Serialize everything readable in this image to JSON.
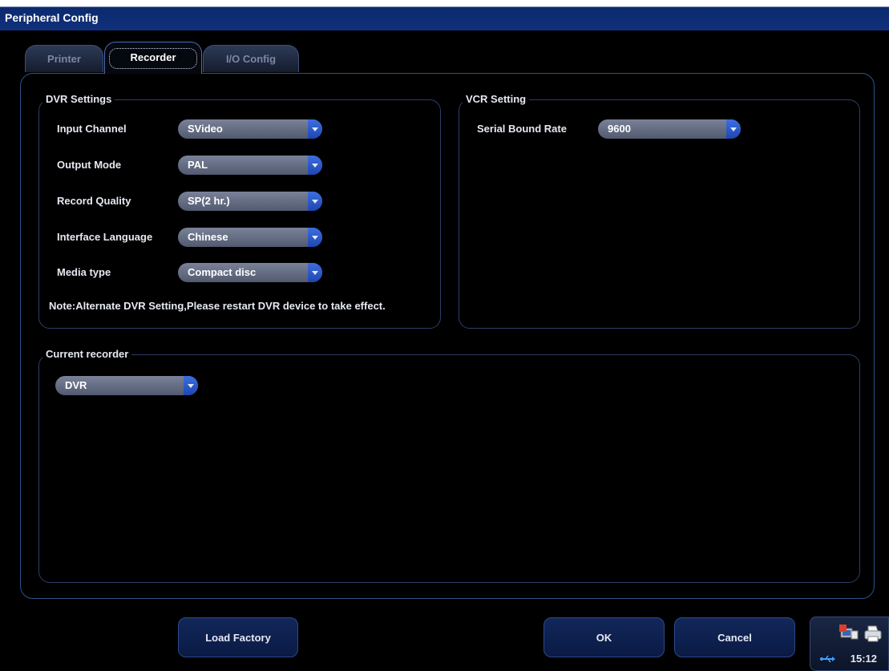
{
  "window": {
    "title": "Peripheral Config"
  },
  "tabs": [
    {
      "label": "Printer",
      "active": false
    },
    {
      "label": "Recorder",
      "active": true
    },
    {
      "label": "I/O Config",
      "active": false
    }
  ],
  "dvr": {
    "title": "DVR Settings",
    "fields": [
      {
        "label": "Input Channel",
        "value": "SVideo"
      },
      {
        "label": "Output Mode",
        "value": "PAL"
      },
      {
        "label": "Record Quality",
        "value": "SP(2 hr.)"
      },
      {
        "label": "Interface Language",
        "value": "Chinese"
      },
      {
        "label": "Media type",
        "value": "Compact disc"
      }
    ],
    "note": "Note:Alternate DVR Setting,Please restart DVR device to take effect."
  },
  "vcr": {
    "title": "VCR Setting",
    "serial_label": "Serial Bound Rate",
    "serial_value": "9600"
  },
  "current_recorder": {
    "title": "Current recorder",
    "value": "DVR"
  },
  "buttons": {
    "load_factory": "Load Factory",
    "ok": "OK",
    "cancel": "Cancel"
  },
  "tray": {
    "clock": "15:12",
    "icons": [
      "network-icon",
      "printer-icon",
      "usb-icon"
    ]
  },
  "colors": {
    "titlebar": "#10307a",
    "accent": "#2e5289",
    "combo_arrow": "#2f5fd0"
  }
}
